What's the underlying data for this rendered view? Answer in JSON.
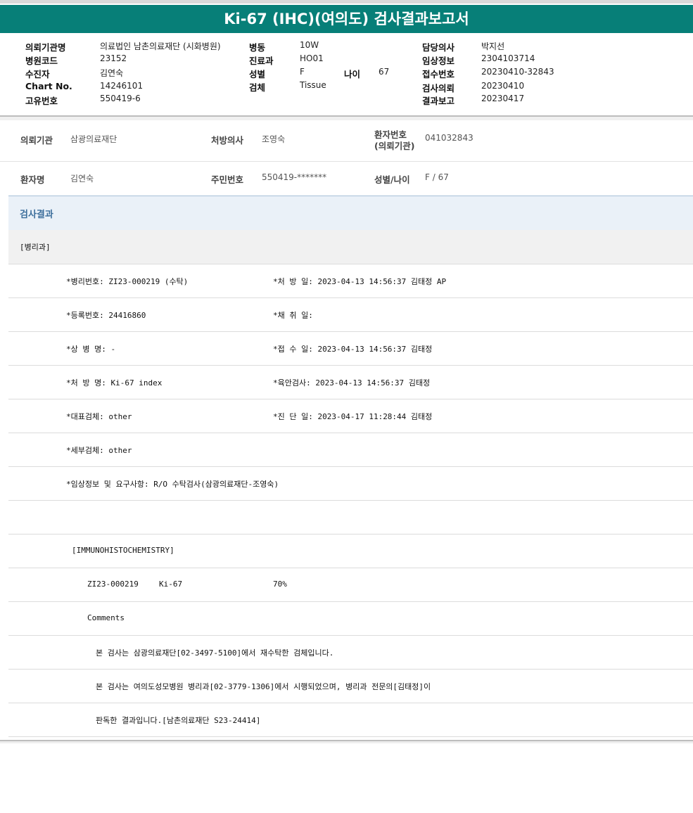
{
  "title": "Ki-67 (IHC)(여의도) 검사결과보고서",
  "header": {
    "col1": [
      {
        "label": "의뢰기관명",
        "value": "의료법인 남촌의료재단 (시화병원)"
      },
      {
        "label": "병원코드",
        "value": "23152"
      },
      {
        "label": "수진자",
        "value": "김연숙"
      },
      {
        "label": "Chart No.",
        "value": "14246101"
      },
      {
        "label": "고유번호",
        "value": "550419-6"
      }
    ],
    "col2": [
      {
        "label": "병동",
        "value": "10W"
      },
      {
        "label": "진료과",
        "value": "HO01"
      },
      {
        "label": "성별",
        "value": "F"
      },
      {
        "label": "검체",
        "value": "Tissue"
      }
    ],
    "age": {
      "label": "나이",
      "value": "67"
    },
    "col3": [
      {
        "label": "담당의사",
        "value": "박지선"
      },
      {
        "label": "임상정보",
        "value": "2304103714"
      },
      {
        "label": "접수번호",
        "value": "20230410-32843"
      },
      {
        "label": "검사의뢰",
        "value": "20230410"
      },
      {
        "label": "결과보고",
        "value": "20230417"
      }
    ]
  },
  "info": {
    "row1": {
      "org_label": "의뢰기관",
      "org_value": "삼광의료재단",
      "doctor_label": "처방의사",
      "doctor_value": "조영숙",
      "pid_label_1": "환자번호",
      "pid_label_2": "(의뢰기관)",
      "pid_value": "041032843"
    },
    "row2": {
      "name_label": "환자명",
      "name_value": "김연숙",
      "rrn_label": "주민번호",
      "rrn_value": "550419-*******",
      "sexage_label": "성별/나이",
      "sexage_value": "F / 67"
    }
  },
  "result_heading": "검사결과",
  "dept": "[병리과]",
  "rows": [
    {
      "left": "*병리번호: ZI23-000219 (수탁)",
      "right": "*처 방 일: 2023-04-13 14:56:37  김태정 AP"
    },
    {
      "left": "*등록번호: 24416860",
      "right": "*채 취 일:"
    },
    {
      "left": "*상 병 명: -",
      "right": "*접 수 일: 2023-04-13 14:56:37  김태정"
    },
    {
      "left": "*처 방 명: Ki-67 index",
      "right": "*육안검사: 2023-04-13 14:56:37  김태정"
    },
    {
      "left": "*대표검체: other",
      "right": "*진 단 일: 2023-04-17 11:28:44  김태정"
    },
    {
      "left": "*세부검체: other",
      "right": ""
    },
    {
      "left": "*임상정보 및 요구사항: R/O 수탁검사(삼광의료재단-조영숙)",
      "right": ""
    }
  ],
  "ihc_heading": "[IMMUNOHISTOCHEMISTRY]",
  "ihc_result": {
    "id": "ZI23-000219",
    "marker": "Ki-67",
    "value": "70%"
  },
  "comments_label": "Comments",
  "comments": [
    "본 검사는 삼광의료재단[02-3497-5100]에서 재수탁한 검체입니다.",
    "본 검사는 여의도성모병원 병리과[02-3779-1306]에서 시행되었으며, 병리과 전문의[김태정]이",
    "판독한 결과입니다.[남촌의료재단 S23-24414]"
  ]
}
